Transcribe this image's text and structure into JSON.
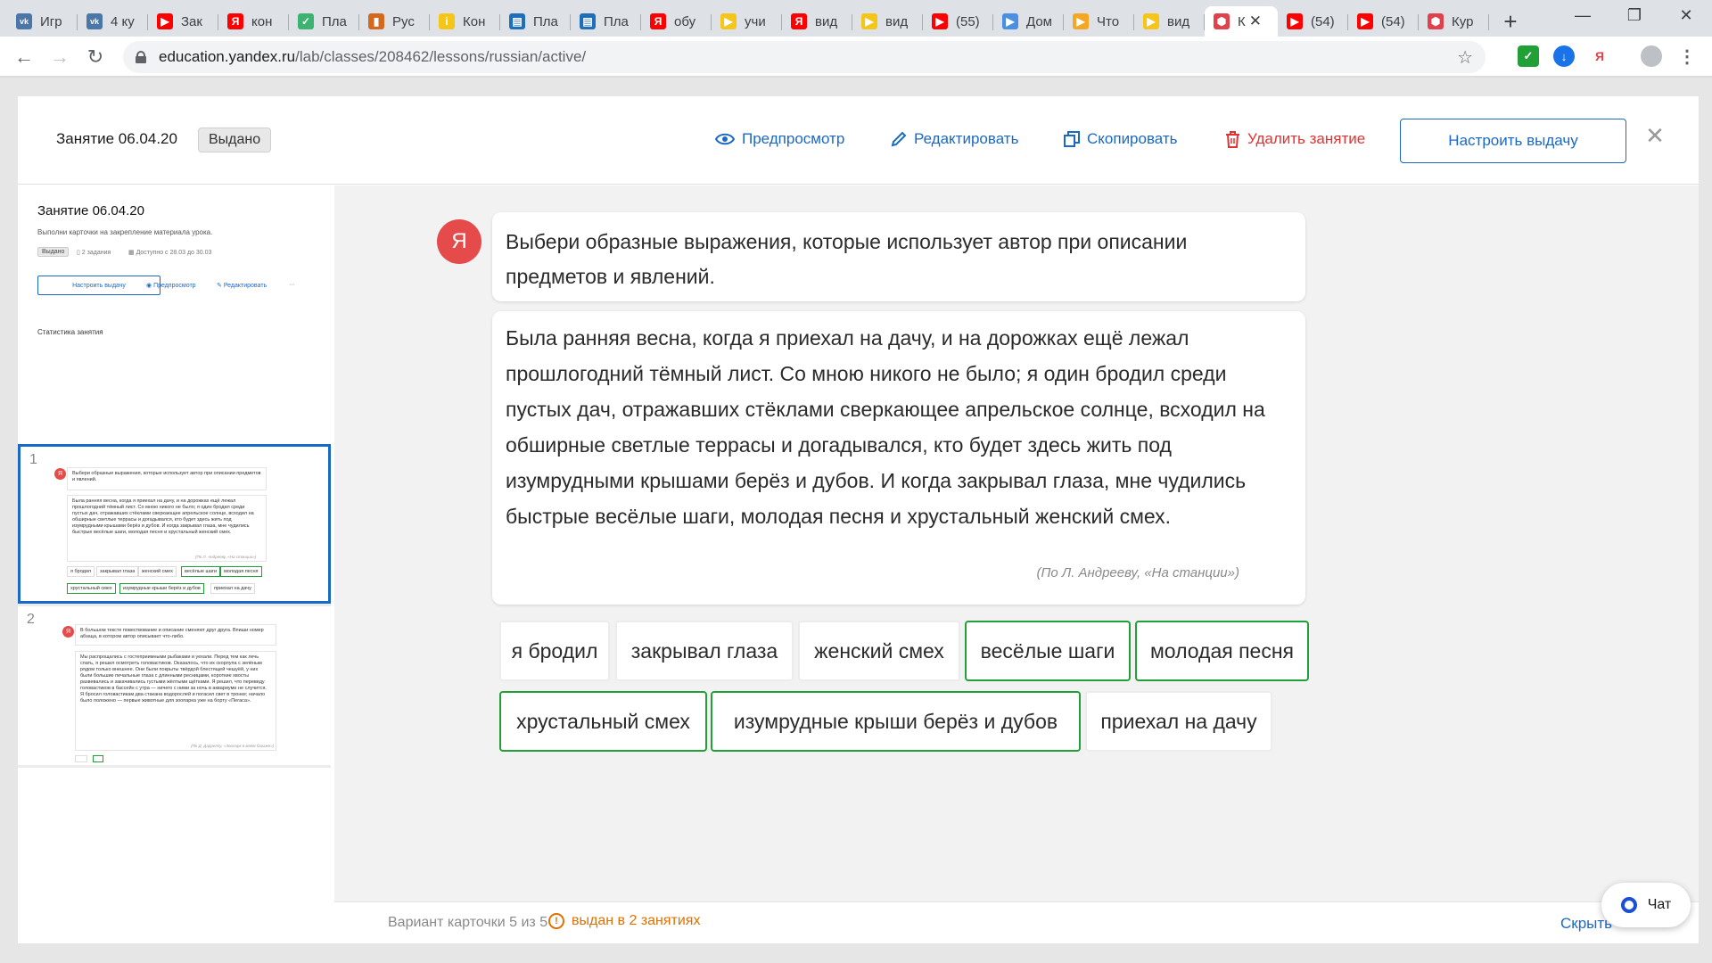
{
  "browser": {
    "tabs": [
      {
        "title": "Игр",
        "color": "#4a76a8",
        "glyph": "vk"
      },
      {
        "title": "4 ку",
        "color": "#4a76a8",
        "glyph": "vk"
      },
      {
        "title": "Зак",
        "color": "#ff0000",
        "glyph": "youtube"
      },
      {
        "title": "кон",
        "color": "#ff0000",
        "glyph": "Я"
      },
      {
        "title": "Пла",
        "color": "#3cb371",
        "glyph": "check"
      },
      {
        "title": "Рус",
        "color": "#d2691e",
        "glyph": "chart"
      },
      {
        "title": "Кон",
        "color": "#f5c518",
        "glyph": "i"
      },
      {
        "title": "Пла",
        "color": "#1e6fb7",
        "glyph": "book"
      },
      {
        "title": "Пла",
        "color": "#1e6fb7",
        "glyph": "book"
      },
      {
        "title": "обу",
        "color": "#ff0000",
        "glyph": "Я"
      },
      {
        "title": "учи",
        "color": "#f5c518",
        "glyph": "play"
      },
      {
        "title": "вид",
        "color": "#ff0000",
        "glyph": "Я"
      },
      {
        "title": "вид",
        "color": "#f5c518",
        "glyph": "play"
      },
      {
        "title": "(55)",
        "color": "#ff0000",
        "glyph": "youtube"
      },
      {
        "title": "Дом",
        "color": "#4a90e2",
        "glyph": "video"
      },
      {
        "title": "Что",
        "color": "#f5a623",
        "glyph": "play"
      },
      {
        "title": "вид",
        "color": "#f5c518",
        "glyph": "play"
      },
      {
        "title": "К",
        "color": "#e0414b",
        "glyph": "hex",
        "active": true
      },
      {
        "title": "(54)",
        "color": "#ff0000",
        "glyph": "youtube"
      },
      {
        "title": "(54)",
        "color": "#ff0000",
        "glyph": "youtube"
      },
      {
        "title": "Кур",
        "color": "#e0414b",
        "glyph": "hex"
      }
    ],
    "url_host": "education.yandex.ru",
    "url_path": "/lab/classes/208462/lessons/russian/active/"
  },
  "header": {
    "lesson_title": "Занятие 06.04.20",
    "status": "Выдано",
    "preview": "Предпросмотр",
    "edit": "Редактировать",
    "copy": "Скопировать",
    "delete": "Удалить занятие",
    "setup": "Настроить выдачу"
  },
  "sidebar": {
    "title": "Занятие 06.04.20",
    "description": "Выполни карточки на закрепление материала урока.",
    "status": "Выдано",
    "tasks_count": "2 задания",
    "available": "Доступно с 28.03 до 30.03",
    "setup": "Настроить выдачу",
    "preview": "Предпросмотр",
    "edit": "Редактировать",
    "more": "···",
    "stats": "Статистика занятия",
    "items": [
      {
        "num": "1",
        "question": "Выбери образные выражения, которые использует автор при описании предметов и явлений.",
        "text": "Была ранняя весна, когда я приехал на дачу, и на дорожках ещё лежал прошлогодний тёмный лист. Со мною никого не было; я один бродил среди пустых дач, отражавших стёклами сверкающее апрельское солнце, всходил на обширные светлые террасы и догадывался, кто будет здесь жить под изумрудными крышами берёз и дубов. И когда закрывал глаза, мне чудились быстрые весёлые шаги, молодая песня и хрустальный женский смех.",
        "author": "(По Л. Андрееву, «На станции»)"
      },
      {
        "num": "2",
        "question": "В большом тексте повествование и описание сменяют друг друга. Впиши номер абзаца, в котором автор описывает что-либо.",
        "text": "Мы распрощались с гостеприимными рыбаками и уехали. Перед тем как лечь спать, я решил осмотреть головастиков. Оказалось, что их скорлупа с зелёным рядом только внешнее. Они были покрыты твёрдой блестящей чешуёй, у них были большие печальные глаза с длинными ресницами, короткие хвосты развевались и закачивались густыми жёлтыми щётками. Я решил, что переведу головастиков в бассейн с утра — ничего с ними за ночь в аквариуме не случится. Я бросил головастикам два стакана водорослей и погасил свет в тронке; начало было положено — первые животные для зоопарка уже на борту «Пегаса».",
        "author": "(По Д. Дарреллу, «Зоопарк в моём багаже»)"
      }
    ]
  },
  "card": {
    "avatar": "Я",
    "question": "Выбери образные выражения, которые использует автор при описании предметов и явлений.",
    "passage": "Была ранняя весна, когда я приехал на дачу, и на дорожках ещё лежал прошлогодний тёмный лист. Со мною никого не было; я один бродил среди пустых дач, отражавших стёклами сверкающее апрельское солнце, всходил на обширные светлые террасы и догадывался, кто будет здесь жить под изумрудными крышами берёз и дубов. И когда закрывал глаза, мне чудились быстрые весёлые шаги, молодая песня и хрустальный женский смех.",
    "author": "(По Л. Андрееву, «На станции»)",
    "options": [
      {
        "label": "я бродил",
        "correct": false
      },
      {
        "label": "закрывал глаза",
        "correct": false
      },
      {
        "label": "женский смех",
        "correct": false
      },
      {
        "label": "весёлые шаги",
        "correct": true
      },
      {
        "label": "молодая песня",
        "correct": true
      },
      {
        "label": "хрустальный смех",
        "correct": true
      },
      {
        "label": "изумрудные крыши берёз и дубов",
        "correct": true
      },
      {
        "label": "приехал на дачу",
        "correct": false
      }
    ]
  },
  "footer": {
    "variant": "Вариант карточки 5 из 5",
    "issued": "выдан в 2 занятиях",
    "hide": "Скрыть"
  },
  "chat": {
    "label": "Чат"
  },
  "colors": {
    "accent": "#1b69c6",
    "danger": "#e23232",
    "correct": "#21a038",
    "warning": "#e07000",
    "yandex": "#e64b4b"
  }
}
